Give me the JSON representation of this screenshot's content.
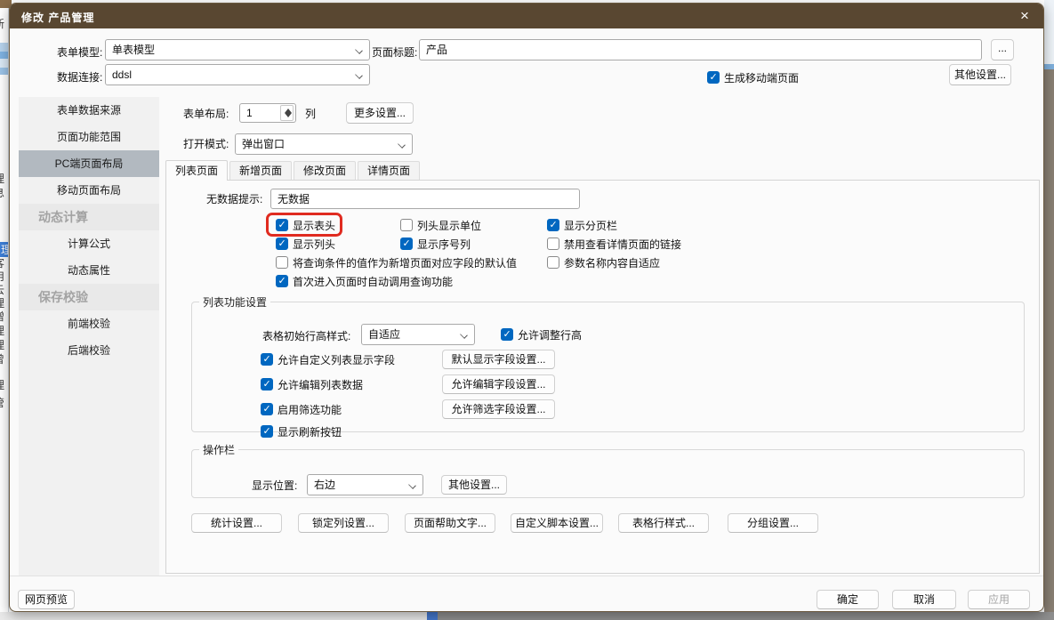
{
  "window": {
    "title": "修改 产品管理",
    "close_icon": "×"
  },
  "header": {
    "form_model_label": "表单模型:",
    "form_model_value": "单表模型",
    "data_connection_label": "数据连接:",
    "data_connection_value": "ddsl",
    "page_title_label": "页面标题:",
    "page_title_value": "产品",
    "page_title_more_label": "...",
    "gen_mobile": {
      "label": "生成移动端页面",
      "checked": true
    },
    "other_settings_label": "其他设置..."
  },
  "sidebar": {
    "items": [
      {
        "label": "表单数据来源",
        "type": "item"
      },
      {
        "label": "页面功能范围",
        "type": "item"
      },
      {
        "label": "PC端页面布局",
        "type": "item",
        "selected": true
      },
      {
        "label": "移动页面布局",
        "type": "item"
      },
      {
        "label": "动态计算",
        "type": "header"
      },
      {
        "label": "计算公式",
        "type": "child"
      },
      {
        "label": "动态属性",
        "type": "child"
      },
      {
        "label": "保存校验",
        "type": "header"
      },
      {
        "label": "前端校验",
        "type": "child"
      },
      {
        "label": "后端校验",
        "type": "child"
      }
    ]
  },
  "form_layout": {
    "label": "表单布局:",
    "value": "1",
    "unit": "列",
    "more_button_label": "更多设置..."
  },
  "open_mode": {
    "label": "打开模式:",
    "value": "弹出窗口"
  },
  "tabs": {
    "active": "列表页面",
    "items": [
      {
        "label": "列表页面"
      },
      {
        "label": "新增页面"
      },
      {
        "label": "修改页面"
      },
      {
        "label": "详情页面"
      }
    ]
  },
  "list_tab": {
    "no_data_label": "无数据提示:",
    "no_data_value": "无数据",
    "checks": {
      "show_table_header": {
        "label": "显示表头",
        "checked": true,
        "highlighted": true
      },
      "col_header_unit": {
        "label": "列头显示单位",
        "checked": false
      },
      "show_pagination": {
        "label": "显示分页栏",
        "checked": true
      },
      "show_col_header": {
        "label": "显示列头",
        "checked": true
      },
      "show_seq_col": {
        "label": "显示序号列",
        "checked": true
      },
      "disable_detail_link": {
        "label": "禁用查看详情页面的链接",
        "checked": false
      },
      "query_as_default": {
        "label": "将查询条件的值作为新增页面对应字段的默认值",
        "checked": false
      },
      "param_name_autofit": {
        "label": "参数名称内容自适应",
        "checked": false
      },
      "auto_query_on_enter": {
        "label": "首次进入页面时自动调用查询功能",
        "checked": true
      }
    },
    "list_func": {
      "legend": "列表功能设置",
      "row_height_label": "表格初始行高样式:",
      "row_height_value": "自适应",
      "allow_adjust_row_height": {
        "label": "允许调整行高",
        "checked": true
      },
      "allow_custom_fields": {
        "label": "允许自定义列表显示字段",
        "checked": true
      },
      "default_fields_button": "默认显示字段设置...",
      "allow_edit_data": {
        "label": "允许编辑列表数据",
        "checked": true
      },
      "edit_fields_button": "允许编辑字段设置...",
      "enable_filter": {
        "label": "启用筛选功能",
        "checked": true
      },
      "filter_fields_button": "允许筛选字段设置...",
      "show_refresh": {
        "label": "显示刷新按钮",
        "checked": true
      }
    },
    "action_bar": {
      "legend": "操作栏",
      "position_label": "显示位置:",
      "position_value": "右边",
      "other_button_label": "其他设置..."
    },
    "bottom_buttons": [
      "统计设置...",
      "锁定列设置...",
      "页面帮助文字...",
      "自定义脚本设置...",
      "表格行样式...",
      "分组设置..."
    ]
  },
  "footer": {
    "preview_label": "网页预览",
    "ok_label": "确定",
    "cancel_label": "取消",
    "apply_label": "应用"
  },
  "background": {
    "left_chars": [
      "新",
      "理",
      "息",
      "理",
      "客",
      "用",
      "云",
      "理",
      "增",
      "理",
      "理",
      "曾",
      "理",
      "管"
    ],
    "highlighted_char_index": 3
  },
  "colors": {
    "titlebar_brown": "#594731",
    "accent_blue": "#0067c0",
    "sidebar_selected": "#b2b9c0",
    "annotation_red": "#e02b20"
  }
}
